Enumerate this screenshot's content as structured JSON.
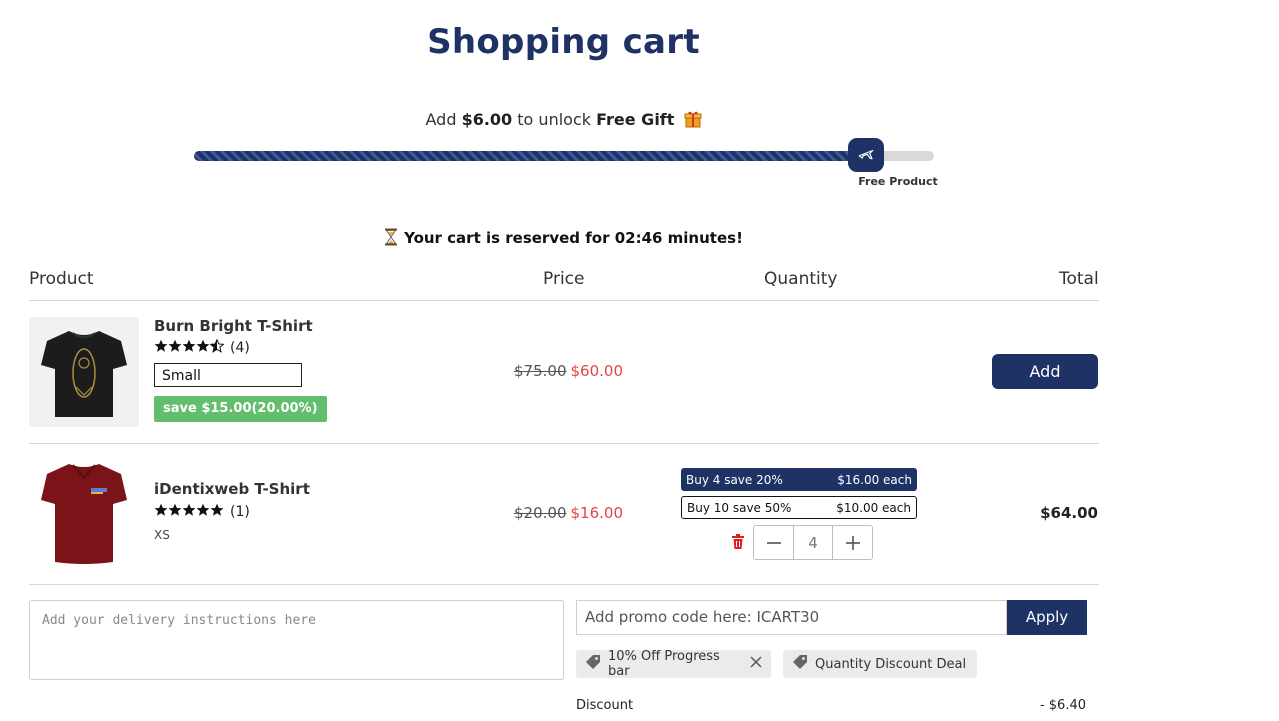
{
  "page": {
    "title": "Shopping cart"
  },
  "progress": {
    "prefix": "Add",
    "amount": "$6.00",
    "middle": "to unlock",
    "reward": "Free Gift",
    "fill_fraction": 0.9,
    "milestone_label": "Free Product"
  },
  "reservation": {
    "text": "Your cart is reserved for 02:46 minutes!"
  },
  "table_headers": {
    "product": "Product",
    "price": "Price",
    "quantity": "Quantity",
    "total": "Total"
  },
  "items": [
    {
      "name": "Burn Bright T-Shirt",
      "rating": 4.5,
      "review_count": "(4)",
      "variant": "Small",
      "save_badge": "save $15.00(20.00%)",
      "old_price": "$75.00",
      "new_price": "$60.00",
      "action_label": "Add"
    },
    {
      "name": "iDentixweb T-Shirt",
      "rating": 5,
      "review_count": "(1)",
      "variant": "XS",
      "old_price": "$20.00",
      "new_price": "$16.00",
      "tiers": [
        {
          "label": "Buy 4 save 20%",
          "price": "$16.00 each"
        },
        {
          "label": "Buy 10 save 50%",
          "price": "$10.00 each"
        }
      ],
      "quantity": "4",
      "total": "$64.00"
    }
  ],
  "delivery": {
    "placeholder": "Add your delivery instructions here"
  },
  "promo": {
    "placeholder": "Add promo code here: ICART30",
    "apply_label": "Apply"
  },
  "discount_chips": [
    {
      "label": "10% Off Progress bar",
      "removable": true
    },
    {
      "label": "Quantity Discount Deal",
      "removable": false
    }
  ],
  "summary": {
    "discount_label": "Discount",
    "discount_value": "- $6.40"
  },
  "colors": {
    "primary": "#1f3266",
    "sale_red": "#e04646",
    "save_green": "#62bd6d",
    "gift": "#f0a020",
    "trash": "#e02020"
  }
}
